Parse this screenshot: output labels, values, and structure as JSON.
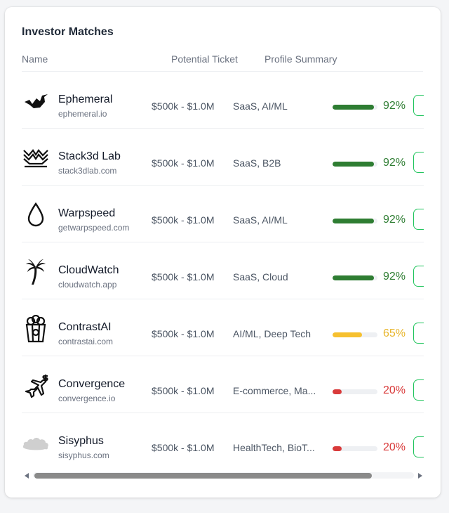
{
  "card": {
    "title": "Investor Matches",
    "columns": {
      "name": "Name",
      "ticket": "Potential Ticket",
      "summary": "Profile Summary"
    }
  },
  "colors": {
    "high": "#2e7d32",
    "medium": "#f6c02f",
    "low": "#d93a3a",
    "medium_text": "#e8b52a",
    "low_text": "#d93a3a",
    "action_border": "#22c55e"
  },
  "rows": [
    {
      "name": "Ephemeral",
      "domain": "ephemeral.io",
      "ticket": "$500k - $1.0M",
      "summary": "SaaS, AI/ML",
      "match": 0.92,
      "match_label": "92%",
      "level": "high",
      "logo": "bird-icon"
    },
    {
      "name": "Stack3d Lab",
      "domain": "stack3dlab.com",
      "ticket": "$500k - $1.0M",
      "summary": "SaaS, B2B",
      "match": 0.92,
      "match_label": "92%",
      "level": "high",
      "logo": "stacked-waves-icon"
    },
    {
      "name": "Warpspeed",
      "domain": "getwarpspeed.com",
      "ticket": "$500k - $1.0M",
      "summary": "SaaS, AI/ML",
      "match": 0.92,
      "match_label": "92%",
      "level": "high",
      "logo": "water-drop-icon"
    },
    {
      "name": "CloudWatch",
      "domain": "cloudwatch.app",
      "ticket": "$500k - $1.0M",
      "summary": "SaaS, Cloud",
      "match": 0.92,
      "match_label": "92%",
      "level": "high",
      "logo": "palm-tree-icon"
    },
    {
      "name": "ContrastAI",
      "domain": "contrastai.com",
      "ticket": "$500k - $1.0M",
      "summary": "AI/ML, Deep Tech",
      "match": 0.65,
      "match_label": "65%",
      "level": "medium",
      "logo": "popcorn-icon"
    },
    {
      "name": "Convergence",
      "domain": "convergence.io",
      "ticket": "$500k - $1.0M",
      "summary": "E-commerce, Ma...",
      "match": 0.2,
      "match_label": "20%",
      "level": "low",
      "logo": "airplane-dollar-icon"
    },
    {
      "name": "Sisyphus",
      "domain": "sisyphus.com",
      "ticket": "$500k - $1.0M",
      "summary": "HealthTech, BioT...",
      "match": 0.2,
      "match_label": "20%",
      "level": "low",
      "logo": "cloud-icon"
    }
  ]
}
